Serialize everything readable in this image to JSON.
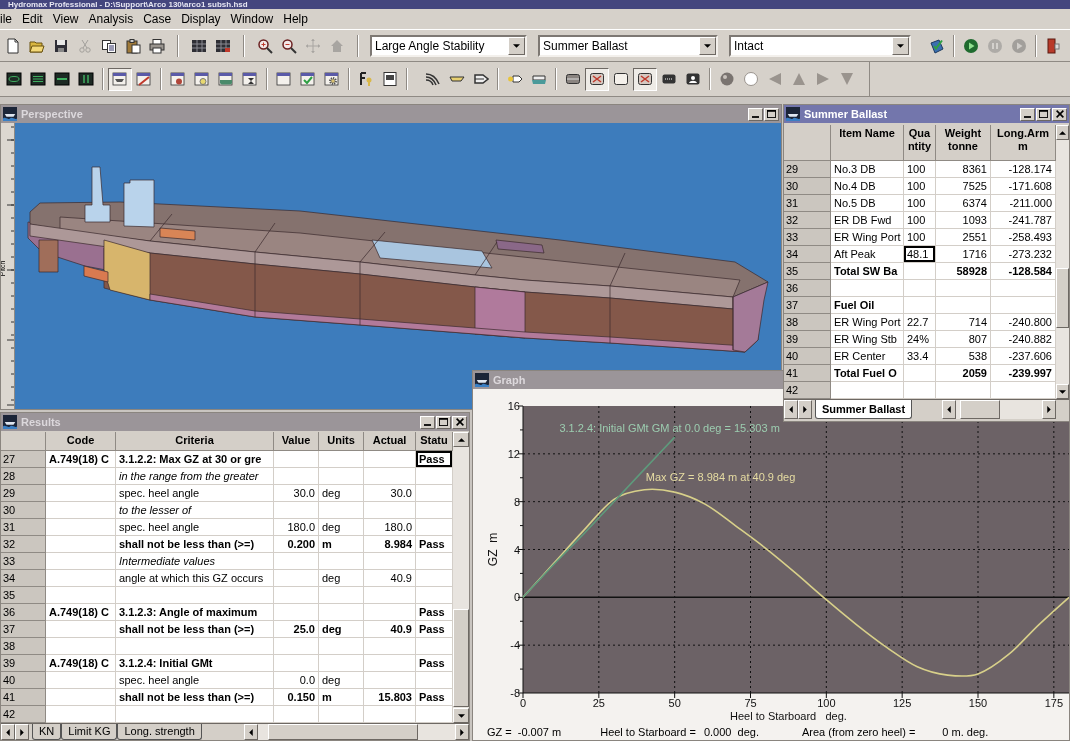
{
  "app": {
    "title": "Hydromax Professional - D:\\Support\\Arco 130\\arco1 subsh.hsd"
  },
  "menu": [
    "ile",
    "Edit",
    "View",
    "Analysis",
    "Case",
    "Display",
    "Window",
    "Help"
  ],
  "toolbar_1": {
    "groups": [
      {
        "kind": "buttons",
        "buttons": [
          {
            "disabled": false
          },
          {
            "disabled": false
          },
          {
            "disabled": false
          },
          {
            "disabled": true
          },
          {
            "disabled": false
          },
          {
            "disabled": false
          },
          {
            "disabled": false
          }
        ]
      },
      {
        "kind": "buttons",
        "buttons": [
          {
            "disabled": false
          },
          {
            "disabled": false
          }
        ]
      },
      {
        "kind": "buttons",
        "buttons": [
          {
            "disabled": false
          },
          {
            "disabled": false
          },
          {
            "disabled": true
          },
          {
            "disabled": true
          }
        ]
      },
      {
        "kind": "dropdowns",
        "dropdowns": [
          {
            "value": "Large Angle Stability"
          },
          {
            "value": "Summer Ballast"
          },
          {
            "value": "Intact"
          }
        ]
      },
      {
        "kind": "buttons",
        "buttons": [
          {
            "disabled": false
          }
        ]
      },
      {
        "kind": "buttons",
        "buttons": [
          {
            "disabled": false
          },
          {
            "disabled": true
          },
          {
            "disabled": true
          }
        ]
      },
      {
        "kind": "buttons",
        "buttons": [
          {
            "disabled": false
          }
        ]
      }
    ]
  },
  "toolbar_2": {
    "groups": [
      {
        "kind": "buttons",
        "buttons": [
          {
            "pressed": false
          },
          {
            "pressed": false
          },
          {
            "pressed": false
          },
          {
            "pressed": false
          }
        ]
      },
      {
        "kind": "buttons",
        "buttons": [
          {
            "pressed": true
          },
          {
            "pressed": false
          }
        ]
      },
      {
        "kind": "buttons",
        "buttons": [
          {
            "pressed": false
          },
          {
            "pressed": false
          },
          {
            "pressed": false
          },
          {
            "pressed": false
          }
        ]
      },
      {
        "kind": "buttons",
        "buttons": [
          {
            "pressed": false
          },
          {
            "pressed": false
          },
          {
            "pressed": false
          }
        ]
      },
      {
        "kind": "buttons",
        "buttons": [
          {
            "pressed": false
          },
          {
            "pressed": false
          }
        ]
      },
      {
        "kind": "buttons",
        "buttons": [
          {
            "pressed": false
          },
          {
            "pressed": false
          },
          {
            "pressed": false
          }
        ]
      },
      {
        "kind": "buttons",
        "buttons": [
          {
            "pressed": false
          },
          {
            "pressed": false
          }
        ]
      },
      {
        "kind": "buttons",
        "buttons": [
          {
            "pressed": false
          },
          {
            "pressed": true
          },
          {
            "pressed": false
          },
          {
            "pressed": true
          },
          {
            "pressed": false
          },
          {
            "pressed": false
          }
        ]
      },
      {
        "kind": "buttons",
        "buttons": [
          {
            "pressed": false
          },
          {
            "pressed": false
          },
          {
            "pressed": false
          },
          {
            "pressed": false
          },
          {
            "pressed": false
          },
          {
            "pressed": false
          }
        ]
      }
    ]
  },
  "perspective": {
    "title": "Perspective",
    "active": false,
    "ruler_label": "Pitch"
  },
  "summer_ballast": {
    "title": "Summer Ballast",
    "active": true,
    "columns": [
      {
        "label": "Item Name"
      },
      {
        "label": "Qua ntity"
      },
      {
        "label": "Weight",
        "unit": "tonne"
      },
      {
        "label": "Long.Arm",
        "unit": "m"
      }
    ],
    "rows": [
      {
        "number": "29",
        "kind": "item",
        "selected": false,
        "item": "No.3 DB",
        "quantity": "100",
        "weight": "8361",
        "arm": "-128.174"
      },
      {
        "number": "30",
        "kind": "item",
        "selected": false,
        "item": "No.4 DB",
        "quantity": "100",
        "weight": "7525",
        "arm": "-171.608"
      },
      {
        "number": "31",
        "kind": "item",
        "selected": false,
        "item": "No.5 DB",
        "quantity": "100",
        "weight": "6374",
        "arm": "-211.000"
      },
      {
        "number": "32",
        "kind": "item",
        "selected": false,
        "item": "ER DB Fwd",
        "quantity": "100",
        "weight": "1093",
        "arm": "-241.787"
      },
      {
        "number": "33",
        "kind": "item",
        "selected": false,
        "item": "ER Wing Port",
        "quantity": "100",
        "weight": "2551",
        "arm": "-258.493"
      },
      {
        "number": "34",
        "kind": "item",
        "selected": true,
        "item": "Aft Peak",
        "quantity": "48.1",
        "weight": "1716",
        "arm": "-273.232"
      },
      {
        "number": "35",
        "kind": "total",
        "selected": false,
        "item": "Total SW Ba",
        "weight": "58928",
        "arm": "-128.584"
      },
      {
        "number": "36",
        "kind": "item",
        "selected": false
      },
      {
        "number": "37",
        "kind": "group",
        "selected": false,
        "item": "Fuel Oil"
      },
      {
        "number": "38",
        "kind": "item",
        "selected": false,
        "item": "ER Wing Port",
        "quantity": "22.7",
        "weight": "714",
        "arm": "-240.800"
      },
      {
        "number": "39",
        "kind": "item",
        "selected": false,
        "item": "ER Wing Stb",
        "quantity": "24%",
        "weight": "807",
        "arm": "-240.882"
      },
      {
        "number": "40",
        "kind": "item",
        "selected": false,
        "item": "ER Center",
        "quantity": "33.4",
        "weight": "538",
        "arm": "-237.606"
      },
      {
        "number": "41",
        "kind": "total",
        "selected": false,
        "item": "Total Fuel O",
        "weight": "2059",
        "arm": "-239.997"
      },
      {
        "number": "42",
        "kind": "item",
        "selected": false
      }
    ],
    "tabs": [
      {
        "label": "Summer Ballast",
        "selected": true
      }
    ]
  },
  "results": {
    "title": "Results",
    "active": false,
    "columns": [
      {
        "label": "Code"
      },
      {
        "label": "Criteria"
      },
      {
        "label": "Value"
      },
      {
        "label": "Units"
      },
      {
        "label": "Actual"
      },
      {
        "label": "Statu"
      }
    ],
    "rows": [
      {
        "number": "27",
        "kind": "heading",
        "selected": true,
        "code": "A.749(18) C",
        "criteria": "3.1.2.2: Max GZ at 30 or gre",
        "status": "Pass"
      },
      {
        "number": "28",
        "kind": "note",
        "selected": false,
        "criteria": "in the range from the greater"
      },
      {
        "number": "29",
        "kind": "item",
        "selected": false,
        "criteria": "spec. heel angle",
        "value": "30.0",
        "units": "deg",
        "actual": "30.0"
      },
      {
        "number": "30",
        "kind": "note",
        "selected": false,
        "criteria": "to the lesser of"
      },
      {
        "number": "31",
        "kind": "item",
        "selected": false,
        "criteria": "spec. heel angle",
        "value": "180.0",
        "units": "deg",
        "actual": "180.0"
      },
      {
        "number": "32",
        "kind": "limit",
        "selected": false,
        "criteria": "shall not be less than (>=)",
        "value": "0.200",
        "units": "m",
        "actual": "8.984",
        "status": "Pass"
      },
      {
        "number": "33",
        "kind": "note",
        "selected": false,
        "criteria": "Intermediate values"
      },
      {
        "number": "34",
        "kind": "item",
        "selected": false,
        "criteria": "angle at which this GZ occurs",
        "units": "deg",
        "actual": "40.9"
      },
      {
        "number": "35",
        "kind": "item",
        "selected": false
      },
      {
        "number": "36",
        "kind": "heading",
        "selected": false,
        "code": "A.749(18) C",
        "criteria": "3.1.2.3: Angle of maximum",
        "status": "Pass"
      },
      {
        "number": "37",
        "kind": "limit",
        "selected": false,
        "criteria": "shall not be less than (>=)",
        "value": "25.0",
        "units": "deg",
        "actual": "40.9",
        "status": "Pass"
      },
      {
        "number": "38",
        "kind": "item",
        "selected": false
      },
      {
        "number": "39",
        "kind": "heading",
        "selected": false,
        "code": "A.749(18) C",
        "criteria": "3.1.2.4: Initial GMt",
        "status": "Pass"
      },
      {
        "number": "40",
        "kind": "item",
        "selected": false,
        "criteria": "spec. heel angle",
        "value": "0.0",
        "units": "deg"
      },
      {
        "number": "41",
        "kind": "limit",
        "selected": false,
        "criteria": "shall not be less than (>=)",
        "value": "0.150",
        "units": "m",
        "actual": "15.803",
        "status": "Pass"
      },
      {
        "number": "42",
        "kind": "item",
        "selected": false
      }
    ],
    "tabs": [
      {
        "label": "KN",
        "selected": false
      },
      {
        "label": "Limit KG",
        "selected": false
      },
      {
        "label": "Long. strength",
        "selected": false
      }
    ]
  },
  "graph": {
    "title": "Graph",
    "active": false,
    "chart_data": {
      "type": "line",
      "xlabel": "Heel to Starboard   deg.",
      "ylabel": "GZ  m",
      "x": [
        0,
        10,
        20,
        30,
        40,
        50,
        60,
        70,
        80,
        90,
        100,
        110,
        120,
        130,
        140,
        150,
        160,
        170,
        180
      ],
      "series": [
        {
          "color": "#d8d08a",
          "values": [
            0,
            2.8,
            5.6,
            8.2,
            9.0,
            8.8,
            7.8,
            6.0,
            4.1,
            2.0,
            -0.2,
            -2.3,
            -4.2,
            -5.8,
            -6.5,
            -6.4,
            -4.8,
            -2.3,
            0
          ]
        },
        {
          "color": "#5e9a7c",
          "values": [
            0,
            2.7,
            5.3,
            8.0,
            10.7,
            13.4,
            null,
            null,
            null,
            null,
            null,
            null,
            null,
            null,
            null,
            null,
            null,
            null,
            null
          ]
        }
      ],
      "xlim": [
        0,
        180
      ],
      "ylim": [
        -8,
        16
      ],
      "xticks": [
        0,
        25,
        50,
        75,
        100,
        125,
        150,
        175
      ],
      "yticks": [
        -8,
        -4,
        0,
        4,
        8,
        12,
        16
      ],
      "grid": true,
      "annotations": [
        "3.1.2.4: Initial GMt GM at 0.0 deg = 15.303 m",
        "Max GZ = 8.984 m at 40.9 deg"
      ]
    },
    "readouts": [
      {
        "label": "GZ =",
        "value": "-0.007 m"
      },
      {
        "label": "Heel to Starboard =",
        "value": "0.000  deg."
      },
      {
        "label": "Area (from zero heel) =",
        "value": "0 m. deg."
      }
    ]
  }
}
